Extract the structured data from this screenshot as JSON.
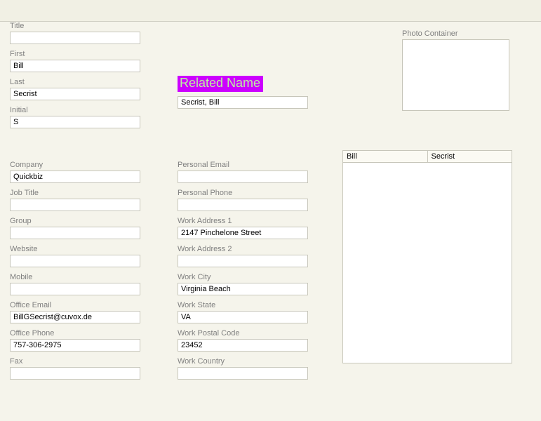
{
  "leftTop": {
    "title": {
      "label": "Title",
      "value": ""
    },
    "first": {
      "label": "First",
      "value": "Bill"
    },
    "last": {
      "label": "Last",
      "value": "Secrist"
    },
    "initial": {
      "label": "Initial",
      "value": "S"
    }
  },
  "leftBottom": {
    "company": {
      "label": "Company",
      "value": "Quickbiz"
    },
    "jobTitle": {
      "label": "Job Title",
      "value": ""
    },
    "group": {
      "label": "Group",
      "value": ""
    },
    "website": {
      "label": "Website",
      "value": ""
    },
    "mobile": {
      "label": "Mobile",
      "value": ""
    },
    "officeEmail": {
      "label": "Office Email",
      "value": "BillGSecrist@cuvox.de"
    },
    "officePhone": {
      "label": "Office Phone",
      "value": "757-306-2975"
    },
    "fax": {
      "label": "Fax",
      "value": ""
    }
  },
  "relatedName": {
    "heading": "Related Name",
    "value": "Secrist, Bill"
  },
  "midBottom": {
    "personalEmail": {
      "label": "Personal Email",
      "value": ""
    },
    "personalPhone": {
      "label": "Personal Phone",
      "value": ""
    },
    "workAddress1": {
      "label": "Work Address 1",
      "value": "2147 Pinchelone Street"
    },
    "workAddress2": {
      "label": "Work Address 2",
      "value": ""
    },
    "workCity": {
      "label": "Work City",
      "value": "Virginia Beach"
    },
    "workState": {
      "label": "Work State",
      "value": "VA"
    },
    "workPostalCode": {
      "label": "Work Postal Code",
      "value": "23452"
    },
    "workCountry": {
      "label": "Work Country",
      "value": ""
    }
  },
  "photoContainerLabel": "Photo Container",
  "listRow": {
    "col1": "Bill",
    "col2": "Secrist"
  }
}
